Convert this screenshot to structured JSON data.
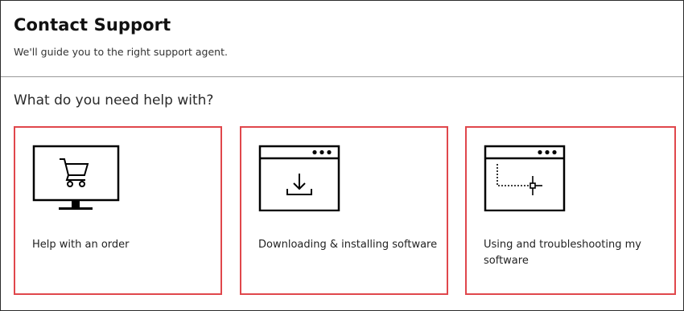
{
  "header": {
    "title": "Contact Support",
    "subtitle": "We'll guide you to the right support agent."
  },
  "prompt": "What do you need help with?",
  "options": [
    {
      "label": "Help with an order",
      "icon": "shopping-cart-monitor-icon"
    },
    {
      "label": "Downloading & installing software",
      "icon": "download-window-icon"
    },
    {
      "label": "Using and troubleshooting my software",
      "icon": "crosshair-window-icon"
    }
  ],
  "colors": {
    "card_border": "#e0474c",
    "text": "#1a1a1a",
    "divider": "#9a9a9a"
  }
}
